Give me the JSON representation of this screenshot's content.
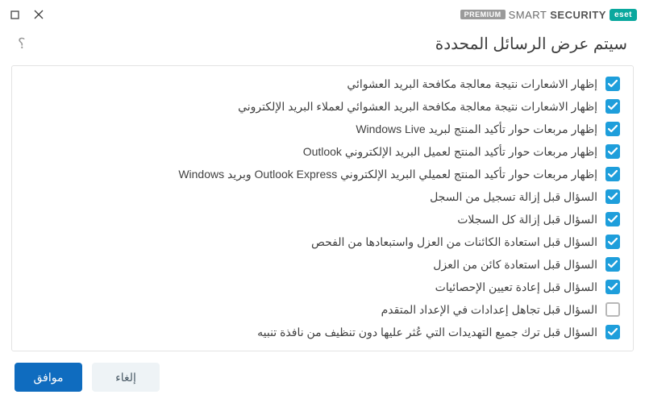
{
  "brand": {
    "badge": "eset",
    "name_light": "SMART",
    "name_bold": "SECURITY",
    "tier": "PREMIUM"
  },
  "heading": "سيتم عرض الرسائل المحددة",
  "items": [
    {
      "label": "إظهار الاشعارات نتيجة معالجة مكافحة البريد العشوائي",
      "checked": true
    },
    {
      "label": "إظهار الاشعارات نتيجة معالجة مكافحة البريد العشوائي لعملاء البريد الإلكتروني",
      "checked": true
    },
    {
      "label": "إظهار مربعات حوار تأكيد المنتج لبريد Windows Live",
      "checked": true
    },
    {
      "label": "إظهار مربعات حوار تأكيد المنتج لعميل البريد الإلكتروني Outlook",
      "checked": true
    },
    {
      "label": "إظهار مربعات حوار تأكيد المنتج لعميلي البريد الإلكتروني Outlook Express وبريد Windows",
      "checked": true
    },
    {
      "label": "السؤال قبل إزالة تسجيل من السجل",
      "checked": true
    },
    {
      "label": "السؤال قبل إزالة كل السجلات",
      "checked": true
    },
    {
      "label": "السؤال قبل استعادة الكائنات من العزل واستبعادها من الفحص",
      "checked": true
    },
    {
      "label": "السؤال قبل استعادة كائن من العزل",
      "checked": true
    },
    {
      "label": "السؤال قبل إعادة تعيين الإحصائيات",
      "checked": true
    },
    {
      "label": "السؤال قبل تجاهل إعدادات في الإعداد المتقدم",
      "checked": false
    },
    {
      "label": "السؤال قبل ترك جميع التهديدات التي عُثر عليها دون تنظيف من نافذة تنبيه",
      "checked": true
    }
  ],
  "footer": {
    "ok": "موافق",
    "cancel": "إلغاء"
  }
}
